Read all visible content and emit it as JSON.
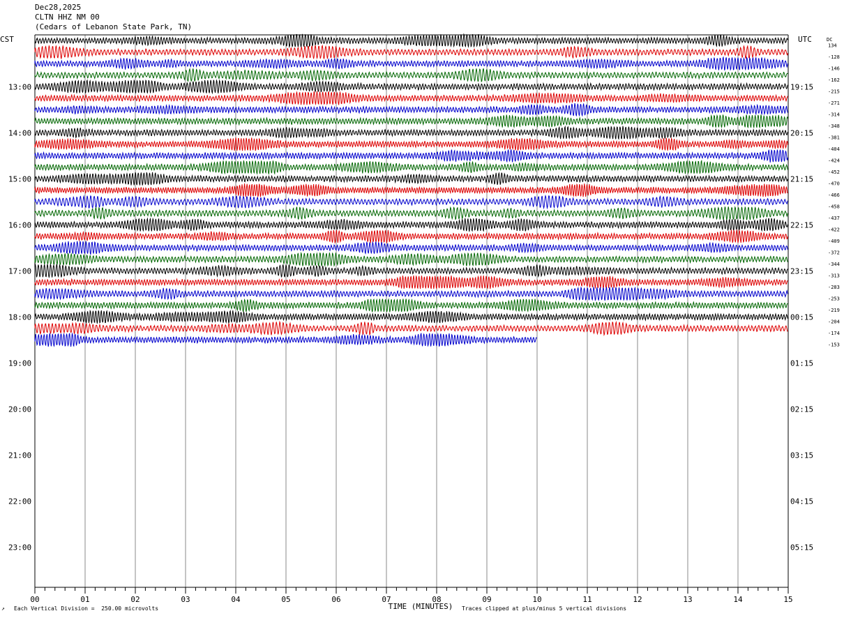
{
  "header": {
    "date": "Dec28,2025",
    "station": "CLTN HHZ NM 00",
    "location": "(Cedars of Lebanon State Park, TN)"
  },
  "labels": {
    "left_tz": "CST",
    "right_tz": "UTC",
    "dc": "DC",
    "xlabel": "TIME (MINUTES)",
    "scale_note": "Each Vertical Division =  250.00 microvolts",
    "clip_note": "Traces clipped at plus/minus 5 vertical divisions"
  },
  "colors": {
    "trace_cycle": [
      "#000000",
      "#dd0000",
      "#0000cc",
      "#006600"
    ],
    "grid": "#888888",
    "axis": "#000000"
  },
  "chart_data": {
    "type": "line",
    "title": "",
    "xlabel": "TIME (MINUTES)",
    "xlim": [
      0,
      15
    ],
    "x_ticks": [
      "00",
      "01",
      "02",
      "03",
      "04",
      "05",
      "06",
      "07",
      "08",
      "09",
      "10",
      "11",
      "12",
      "13",
      "14",
      "15"
    ],
    "left_hour_labels": [
      "13:00",
      "14:00",
      "15:00",
      "16:00",
      "17:00",
      "18:00",
      "19:00",
      "20:00",
      "21:00",
      "22:00",
      "23:00"
    ],
    "right_hour_labels": [
      "19:15",
      "20:15",
      "21:15",
      "22:15",
      "23:15",
      "00:15",
      "01:15",
      "02:15",
      "03:15",
      "04:15",
      "05:15"
    ],
    "rows_total": 48,
    "rows_per_hour": 4,
    "first_hour_label_row": 4,
    "trace_rows": 27,
    "last_row_end_minute": 10,
    "dc_offsets": [
      "134",
      "-128",
      "-146",
      "-162",
      "-215",
      "-271",
      "-314",
      "-348",
      "-381",
      "-404",
      "-424",
      "-452",
      "-470",
      "-466",
      "-458",
      "-437",
      "-422",
      "-409",
      "-372",
      "-344",
      "-313",
      "-283",
      "-253",
      "-219",
      "-204",
      "-174",
      "-153"
    ]
  }
}
